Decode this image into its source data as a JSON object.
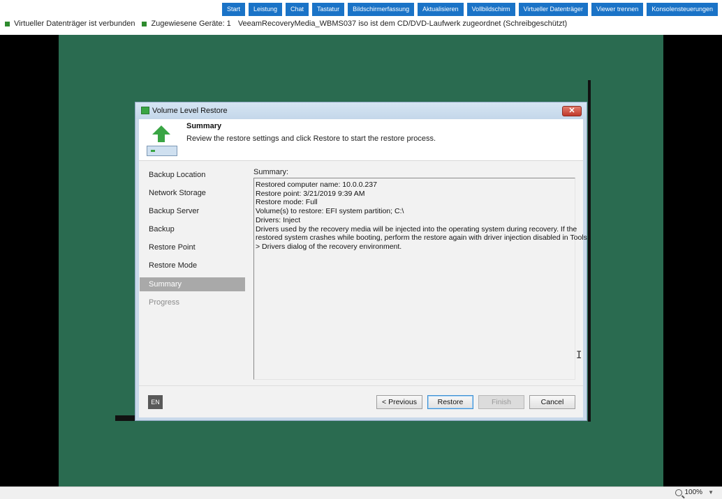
{
  "toolbar": {
    "buttons": [
      "Start",
      "Leistung",
      "Chat",
      "Tastatur",
      "Bildschirmerfassung",
      "Aktualisieren",
      "Vollbildschirm",
      "Virtueller Datenträger",
      "Viewer trennen",
      "Konsolensteuerungen"
    ]
  },
  "status": {
    "virtual_disk": "Virtueller Datenträger ist verbunden",
    "devices": "Zugewiesene Geräte: 1",
    "iso": "VeeamRecoveryMedia_WBMS037 iso ist dem CD/DVD-Laufwerk zugeordnet (Schreibgeschützt)"
  },
  "dialog": {
    "title": "Volume Level Restore",
    "close_label": "✕",
    "header_title": "Summary",
    "header_subtitle": "Review the restore settings and click Restore to start the restore process.",
    "nav": [
      "Backup Location",
      "Network Storage",
      "Backup Server",
      "Backup",
      "Restore Point",
      "Restore Mode",
      "Summary",
      "Progress"
    ],
    "summary_label": "Summary:",
    "summary_lines": [
      "Restored computer name: 10.0.0.237",
      "Restore point: 3/21/2019 9:39 AM",
      "Restore mode: Full",
      "Volume(s) to restore: EFI system partition; C:\\",
      "Drivers: Inject",
      "Drivers used by the recovery media will be injected into the operating system during recovery. If the",
      "restored system crashes while booting, perform the restore again with driver injection disabled in Tools",
      "> Drivers dialog of the recovery environment."
    ],
    "lang": "EN",
    "buttons": {
      "previous": "< Previous",
      "restore": "Restore",
      "finish": "Finish",
      "cancel": "Cancel"
    }
  },
  "zoom": {
    "level": "100%"
  },
  "colors": {
    "toolbar_blue": "#1a73c7",
    "desktop_green": "#2a6b50",
    "status_green": "#2e8b2e"
  }
}
